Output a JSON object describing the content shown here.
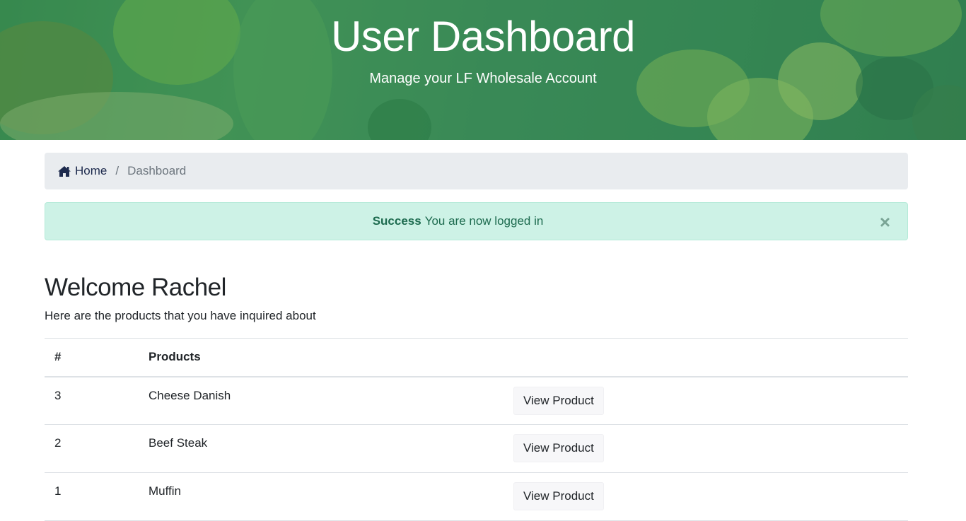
{
  "hero": {
    "title": "User Dashboard",
    "subtitle": "Manage your LF Wholesale Account"
  },
  "breadcrumb": {
    "home_icon": "home-icon",
    "home_label": "Home",
    "separator": "/",
    "current": "Dashboard"
  },
  "alert": {
    "strong": "Success",
    "message": "You are now logged in",
    "close_label": "×"
  },
  "welcome": {
    "heading": "Welcome Rachel",
    "intro": "Here are the products that you have inquired about"
  },
  "table": {
    "headers": [
      "#",
      "Products",
      ""
    ],
    "rows": [
      {
        "id": "3",
        "product": "Cheese Danish",
        "action": "View Product"
      },
      {
        "id": "2",
        "product": "Beef Steak",
        "action": "View Product"
      },
      {
        "id": "1",
        "product": "Muffin",
        "action": "View Product"
      }
    ]
  },
  "colors": {
    "hero_green": "#3f8f4e",
    "alert_bg": "#cdf2e6",
    "alert_text": "#1d6b4f",
    "breadcrumb_bg": "#e9ecef"
  }
}
